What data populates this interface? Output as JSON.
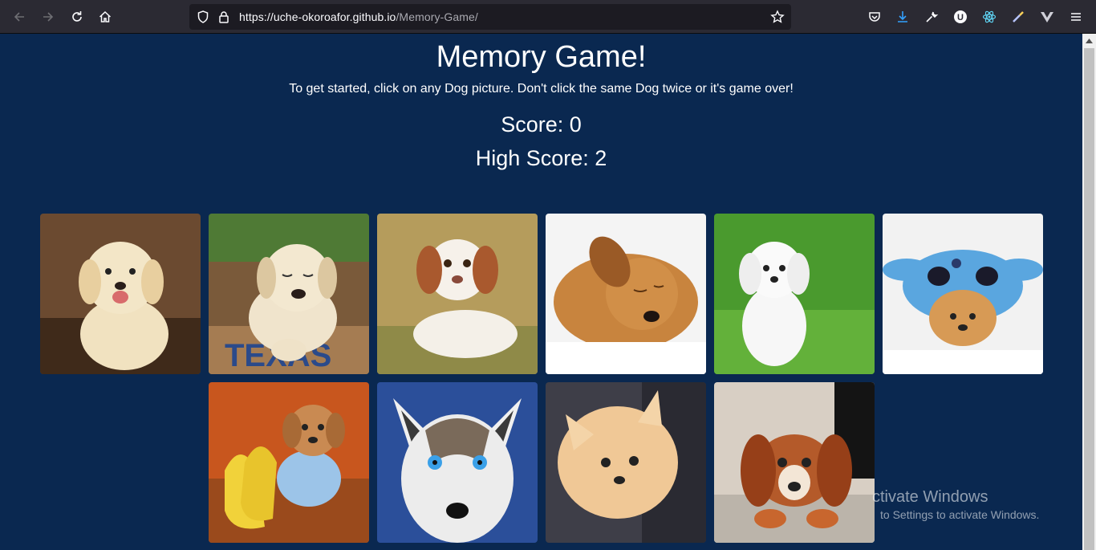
{
  "browser": {
    "url_host": "https://uche-okoroafor.github.io",
    "url_path": "/Memory-Game/"
  },
  "page": {
    "title": "Memory Game!",
    "instructions": "To get started, click on any Dog picture. Don't click the same Dog twice or it's game over!",
    "score_text": "Score: 0",
    "high_score_text": "High Score: 2"
  },
  "cards": [
    {
      "id": 1,
      "icon": "golden-retriever-puppy"
    },
    {
      "id": 2,
      "icon": "labrador-puppy-in-crate"
    },
    {
      "id": 3,
      "icon": "brittany-spaniel-puppy"
    },
    {
      "id": 4,
      "icon": "sleeping-brown-puppy"
    },
    {
      "id": 5,
      "icon": "white-maltese-puppy"
    },
    {
      "id": 6,
      "icon": "pomeranian-in-stitch-costume"
    },
    {
      "id": 7,
      "icon": "puppy-with-bananas"
    },
    {
      "id": 8,
      "icon": "husky-puppy"
    },
    {
      "id": 9,
      "icon": "pomeranian-puppy"
    },
    {
      "id": 10,
      "icon": "cavalier-king-charles-puppy"
    }
  ],
  "watermark": {
    "line1": "ctivate Windows",
    "line2": "to Settings to activate Windows."
  },
  "colors": {
    "page_background": "#0a2850",
    "toolbar": "#2b2a33",
    "text": "#ffffff"
  }
}
